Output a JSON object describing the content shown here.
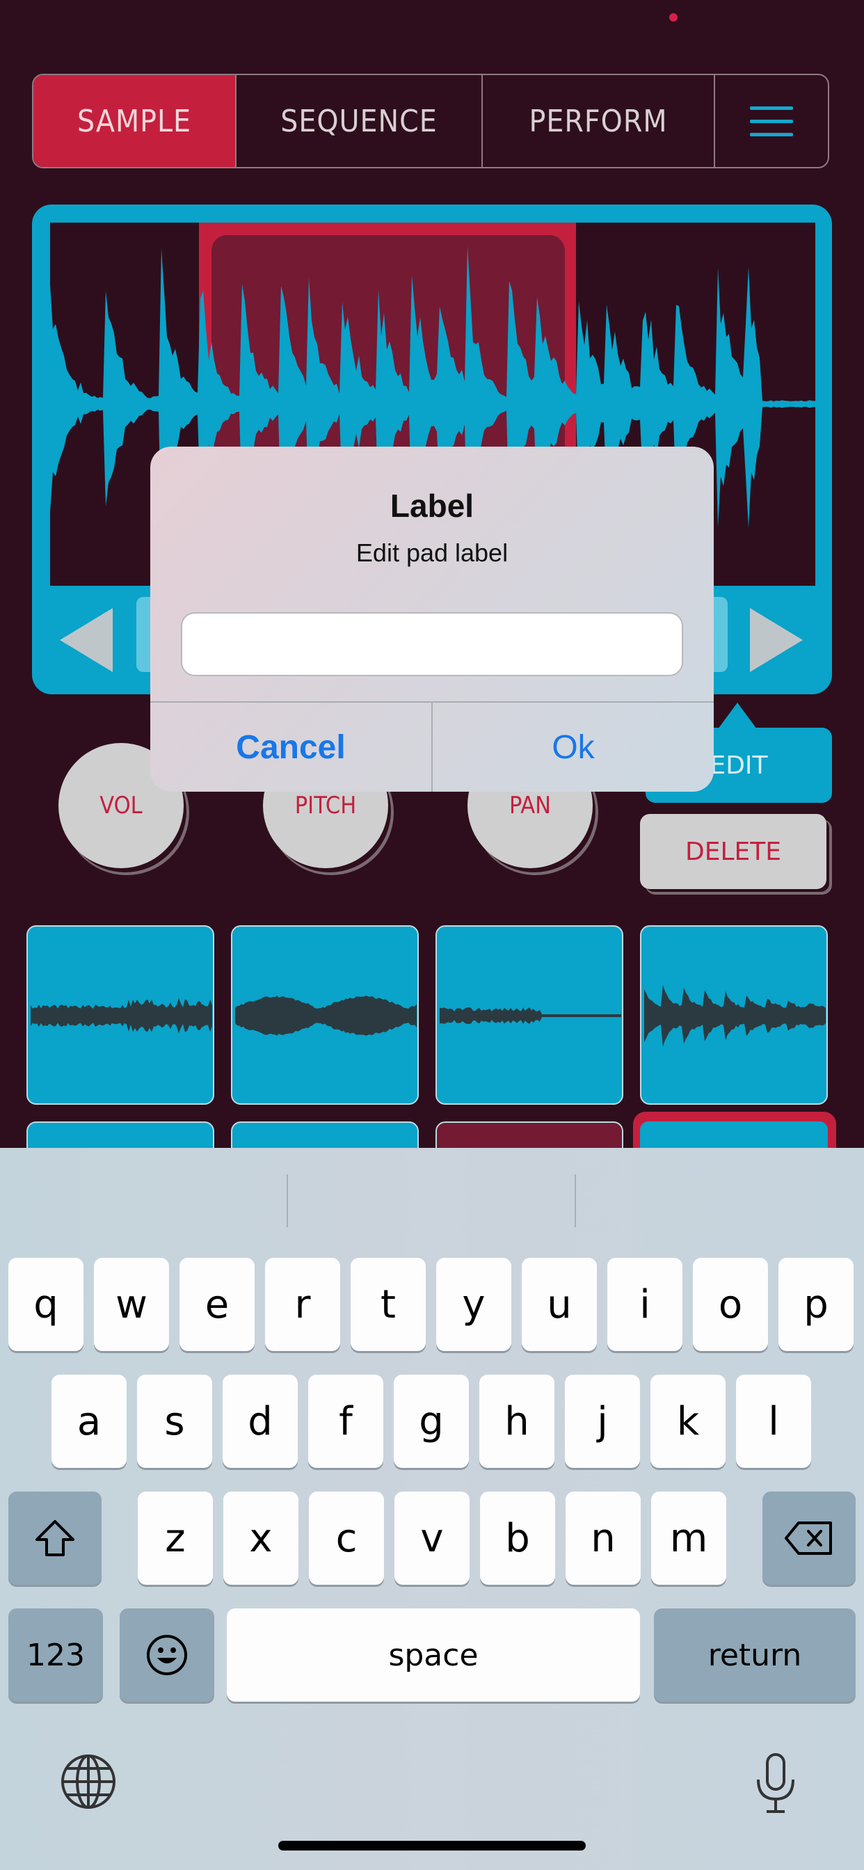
{
  "tabs": [
    {
      "label": "SAMPLE",
      "active": true
    },
    {
      "label": "SEQUENCE",
      "active": false
    },
    {
      "label": "PERFORM",
      "active": false
    }
  ],
  "icons": {
    "menu": "hamburger-menu-icon",
    "left": "left-arrow-icon",
    "right": "right-arrow-icon",
    "shift": "shift-icon",
    "backspace": "backspace-icon",
    "emoji": "emoji-icon",
    "globe": "globe-icon",
    "mic": "microphone-icon"
  },
  "knobs": {
    "vol": "VOL",
    "pitch": "PITCH",
    "pan": "PAN"
  },
  "actions": {
    "edit": "EDIT",
    "delete": "DELETE"
  },
  "dialog": {
    "title": "Label",
    "message": "Edit pad label",
    "input_value": "",
    "cancel": "Cancel",
    "ok": "Ok"
  },
  "keyboard": {
    "row1": [
      "q",
      "w",
      "e",
      "r",
      "t",
      "y",
      "u",
      "i",
      "o",
      "p"
    ],
    "row2": [
      "a",
      "s",
      "d",
      "f",
      "g",
      "h",
      "j",
      "k",
      "l"
    ],
    "row3": [
      "z",
      "x",
      "c",
      "v",
      "b",
      "n",
      "m"
    ],
    "numbers": "123",
    "space": "space",
    "return": "return"
  },
  "colors": {
    "background": "#2e0e1c",
    "accent": "#c4203e",
    "waveform": "#0aa3c9",
    "link": "#1877e8"
  }
}
